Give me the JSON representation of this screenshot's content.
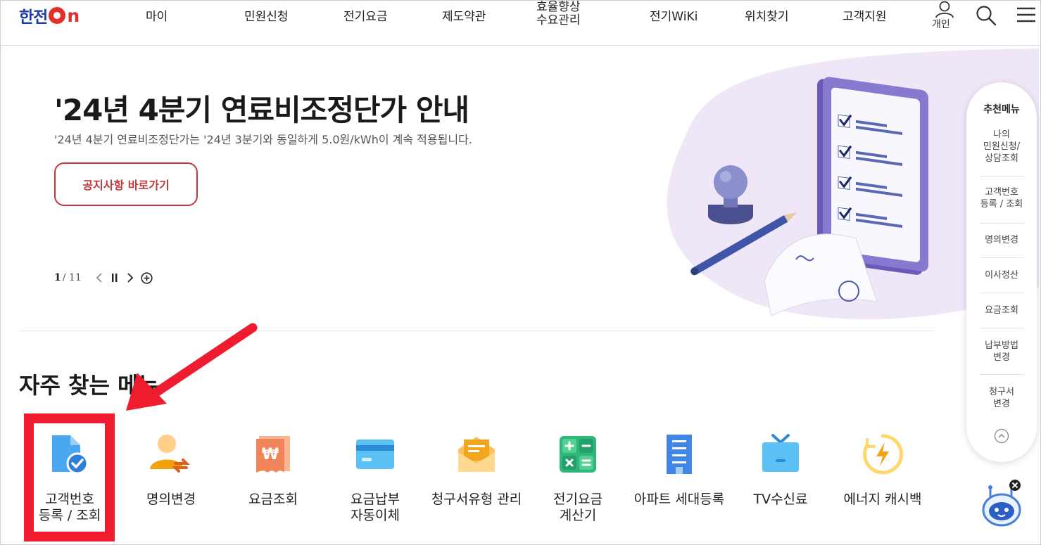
{
  "header": {
    "logo_text": "한전",
    "logo_on": "n",
    "nav": [
      {
        "label": "마이"
      },
      {
        "label": "민원신청"
      },
      {
        "label": "전기요금"
      },
      {
        "label": "제도약관"
      },
      {
        "label_line1": "효율향상",
        "label_line2": "수요관리"
      },
      {
        "label": "전기WiKi"
      },
      {
        "label": "위치찾기"
      },
      {
        "label": "고객지원"
      }
    ],
    "user_label": "개인"
  },
  "hero": {
    "title": "'24년 4분기 연료비조정단가 안내",
    "subtitle": "'24년 4분기 연료비조정단가는 '24년 3분기와 동일하게 5.0원/kWh이 계속 적용됩니다.",
    "button_label": "공지사항 바로가기",
    "pager_current": "1",
    "pager_total": "/ 11"
  },
  "frequent": {
    "title": "자주 찾는 메뉴",
    "items": [
      {
        "line1": "고객번호",
        "line2": "등록 / 조회",
        "icon": "document-check-icon"
      },
      {
        "line1": "명의변경",
        "line2": "",
        "icon": "person-swap-icon"
      },
      {
        "line1": "요금조회",
        "line2": "",
        "icon": "won-receipt-icon"
      },
      {
        "line1": "요금납부",
        "line2": "자동이체",
        "icon": "credit-card-icon"
      },
      {
        "line1": "청구서유형 관리",
        "line2": "",
        "icon": "envelope-icon"
      },
      {
        "line1": "전기요금",
        "line2": "계산기",
        "icon": "calculator-icon"
      },
      {
        "line1": "아파트 세대등록",
        "line2": "",
        "icon": "apartment-icon"
      },
      {
        "line1": "TV수신료",
        "line2": "",
        "icon": "tv-icon"
      },
      {
        "line1": "에너지 캐시백",
        "line2": "",
        "icon": "energy-bolt-icon"
      }
    ]
  },
  "recommend": {
    "title": "추천메뉴",
    "items": [
      {
        "line1": "나의",
        "line2": "민원신청/",
        "line3": "상담조회"
      },
      {
        "line1": "고객번호",
        "line2": "등록 / 조회",
        "line3": ""
      },
      {
        "line1": "명의변경",
        "line2": "",
        "line3": ""
      },
      {
        "line1": "이사정산",
        "line2": "",
        "line3": ""
      },
      {
        "line1": "요금조회",
        "line2": "",
        "line3": ""
      },
      {
        "line1": "납부방법",
        "line2": "변경",
        "line3": ""
      },
      {
        "line1": "청구서",
        "line2": "변경",
        "line3": ""
      }
    ]
  },
  "colors": {
    "brand_blue": "#1d3ea8",
    "brand_red": "#e0302b",
    "accent_button": "#c5383a",
    "highlight": "#ee1c2e"
  }
}
